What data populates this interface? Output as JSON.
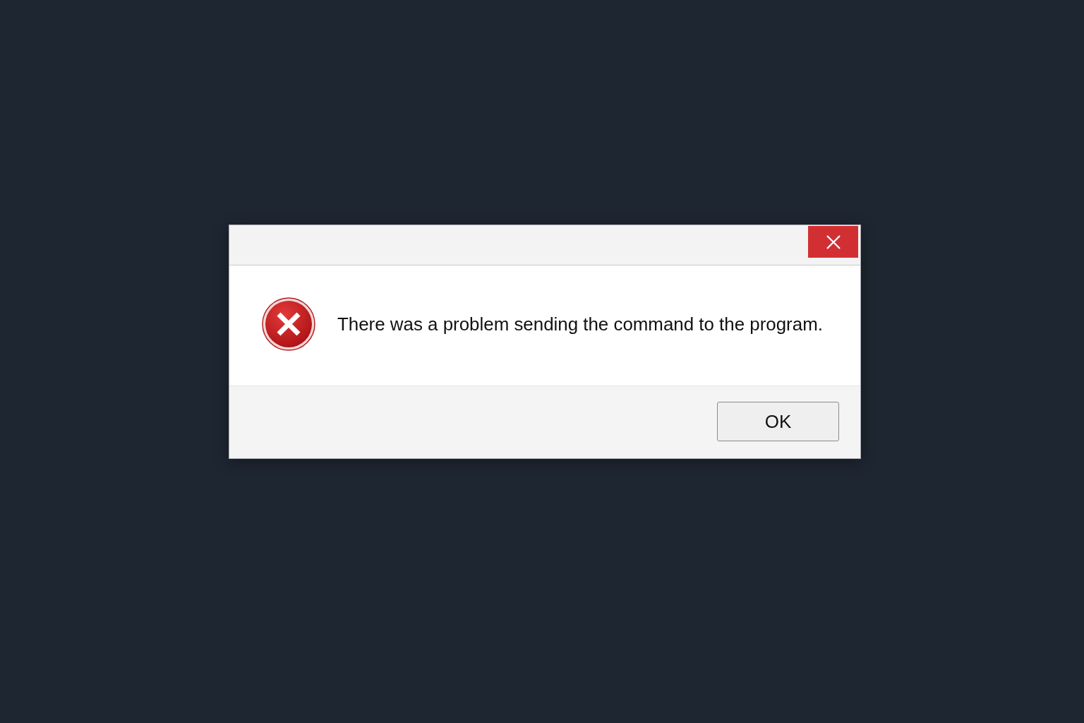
{
  "dialog": {
    "message": "There was a problem sending the command to the program.",
    "buttons": [
      {
        "label": "OK"
      }
    ]
  }
}
